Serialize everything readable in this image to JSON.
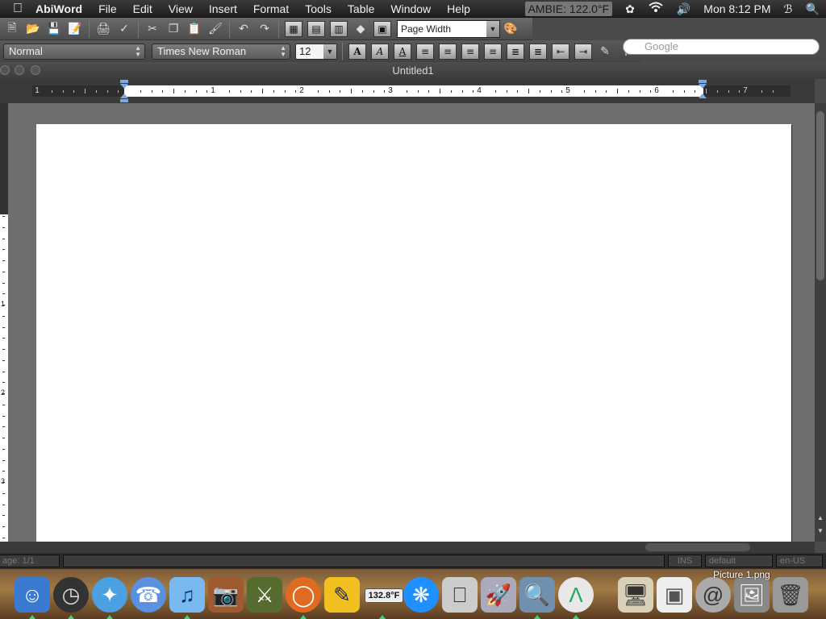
{
  "menubar": {
    "apple_icon": "apple-icon",
    "app_name": "AbiWord",
    "items": [
      "File",
      "Edit",
      "View",
      "Insert",
      "Format",
      "Tools",
      "Table",
      "Window",
      "Help"
    ],
    "ambie": "AMBIE: 122.0°F",
    "clock": "Mon 8:12 PM"
  },
  "toolbar": {
    "zoom_value": "Page Width"
  },
  "format_bar": {
    "style_value": "Normal",
    "font_value": "Times New Roman",
    "size_value": "12"
  },
  "search": {
    "placeholder": "Google"
  },
  "window": {
    "title": "Untitled1"
  },
  "ruler": {
    "numbers_left": [
      "1"
    ],
    "numbers_page": [
      "1",
      "2",
      "3",
      "4",
      "5",
      "6"
    ],
    "numbers_right": [
      "7"
    ]
  },
  "vruler": {
    "numbers": [
      "1",
      "2",
      "3"
    ]
  },
  "statusbar": {
    "page": "age: 1/1",
    "message": "",
    "mode": "INS",
    "style": "default",
    "language": "en-US"
  },
  "dock": {
    "temperature": "132.8°F",
    "file_label": "Picture 1.png"
  }
}
